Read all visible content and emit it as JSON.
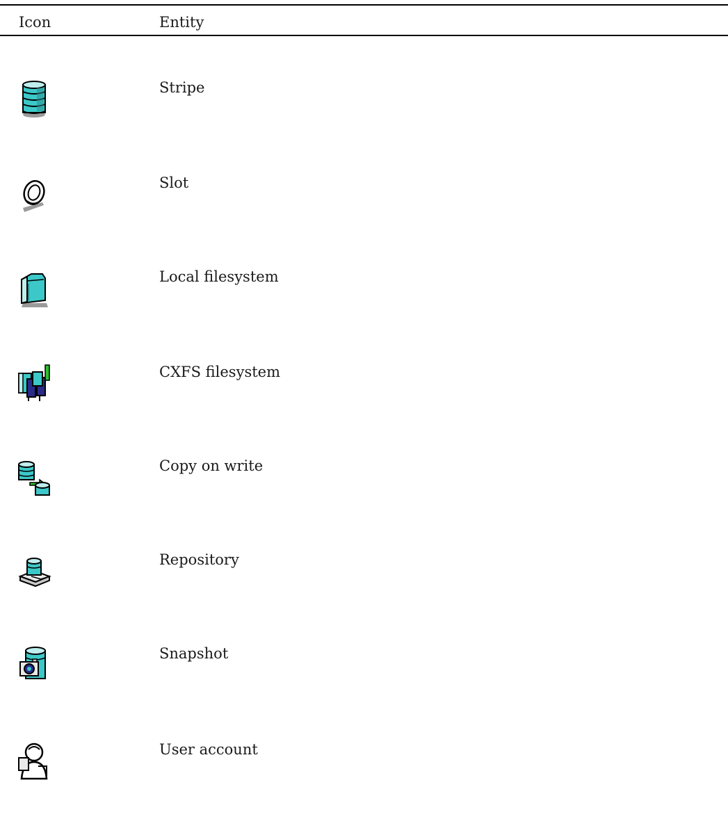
{
  "table": {
    "headers": {
      "icon": "Icon",
      "entity": "Entity"
    },
    "rows": [
      {
        "entity": "Stripe",
        "icon": "stripe-icon"
      },
      {
        "entity": "Slot",
        "icon": "slot-icon"
      },
      {
        "entity": "Local filesystem",
        "icon": "local-filesystem-icon"
      },
      {
        "entity": "CXFS filesystem",
        "icon": "cxfs-filesystem-icon"
      },
      {
        "entity": "Copy on write",
        "icon": "copy-on-write-icon"
      },
      {
        "entity": "Repository",
        "icon": "repository-icon"
      },
      {
        "entity": "Snapshot",
        "icon": "snapshot-icon"
      },
      {
        "entity": "User account",
        "icon": "user-account-icon"
      }
    ]
  },
  "colors": {
    "teal": "#3cc8c8",
    "navy": "#2a2a8a",
    "green": "#2fc02f",
    "outline": "#000000",
    "shadow": "#9a9a9a"
  }
}
